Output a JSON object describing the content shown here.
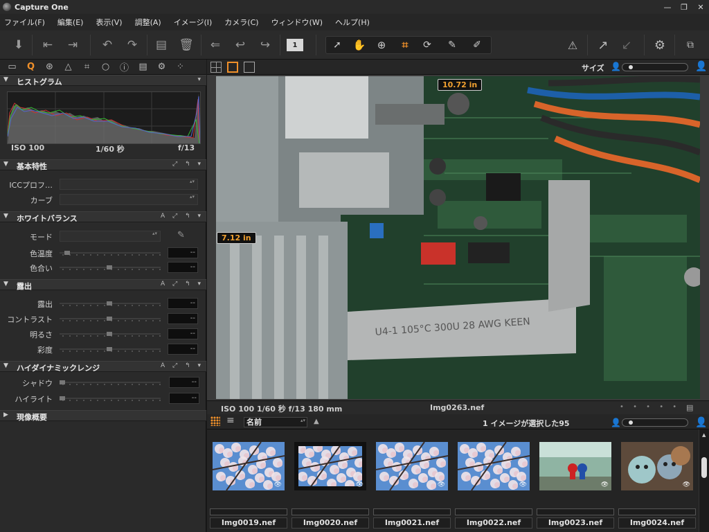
{
  "app": {
    "title": "Capture One"
  },
  "window_controls": {
    "minimize": "—",
    "maximize": "❐",
    "close": "✕"
  },
  "menu": [
    "ファイル(F)",
    "編集(E)",
    "表示(V)",
    "調整(A)",
    "イメージ(I)",
    "カメラ(C)",
    "ウィンドウ(W)",
    "ヘルプ(H)"
  ],
  "toolbar": {
    "icons": [
      "import-icon",
      "edit-previous-icon",
      "edit-next-icon",
      "rotate-left-icon",
      "rotate-right-icon",
      "move-to-icon",
      "trash-icon",
      "undo-all-icon",
      "undo-icon",
      "redo-icon",
      "single-view-icon",
      "select-cursor-icon",
      "pan-hand-icon",
      "zoom-icon",
      "crop-icon",
      "rotate-tool-icon",
      "color-picker-icon",
      "pencil-icon",
      "warning-icon",
      "export-icon",
      "process-icon",
      "settings-icon",
      "camera-info-icon"
    ],
    "page_counter": "1",
    "accent": "#f0902a"
  },
  "tool_tabs": [
    "folder-icon",
    "quick-icon",
    "color-icon",
    "exposure-icon",
    "crop-icon",
    "search-icon",
    "info-icon",
    "list-icon",
    "gear-icon",
    "batch-icon"
  ],
  "tool_tabs_active": "Q",
  "panels": {
    "histogram": {
      "title": "ヒストグラム",
      "iso": "ISO 100",
      "shutter": "1/60 秒",
      "aperture": "f/13"
    },
    "basic": {
      "title": "基本特性",
      "rows": [
        {
          "label": "ICCプロフ…",
          "value": ""
        },
        {
          "label": "カーブ",
          "value": ""
        }
      ]
    },
    "white_balance": {
      "title": "ホワイトバランス",
      "mode_label": "モード",
      "mode_value": "",
      "rows": [
        {
          "label": "色温度",
          "value": "--",
          "level": 0.05
        },
        {
          "label": "色合い",
          "value": "--",
          "level": 0.5
        }
      ]
    },
    "exposure": {
      "title": "露出",
      "rows": [
        {
          "label": "露出",
          "value": "--",
          "level": 0.5
        },
        {
          "label": "コントラスト",
          "value": "--",
          "level": 0.5
        },
        {
          "label": "明るさ",
          "value": "--",
          "level": 0.5
        },
        {
          "label": "彩度",
          "value": "--",
          "level": 0.5
        }
      ]
    },
    "hdr": {
      "title": "ハイダイナミックレンジ",
      "rows": [
        {
          "label": "シャドウ",
          "value": "--",
          "level": 0.0
        },
        {
          "label": "ハイライト",
          "value": "--",
          "level": 0.0
        }
      ]
    },
    "develop": {
      "title": "現像概要"
    },
    "header_icons": "A ⤢ ↰ ▾"
  },
  "viewer": {
    "size_label": "サイズ",
    "size_slider_level": 0.1,
    "crop_width": "10.72 in",
    "crop_height": "7.12 in",
    "meta": "ISO 100   1/60 秒   f/13   180 mm",
    "filename": "Img0263.nef",
    "nav_dots": "• • • • •"
  },
  "browser": {
    "sort_label": "名前",
    "sort_direction": "▲",
    "selection_status": "1 イメージが選択した95",
    "size_slider_level": 0.1,
    "thumbnails": [
      {
        "name": "Img0019.nef",
        "kind": "blossom"
      },
      {
        "name": "Img0020.nef",
        "kind": "blossom-selected"
      },
      {
        "name": "Img0021.nef",
        "kind": "blossom"
      },
      {
        "name": "Img0022.nef",
        "kind": "blossom"
      },
      {
        "name": "Img0023.nef",
        "kind": "toys-room"
      },
      {
        "name": "Img0024.nef",
        "kind": "toys-plush"
      }
    ]
  }
}
